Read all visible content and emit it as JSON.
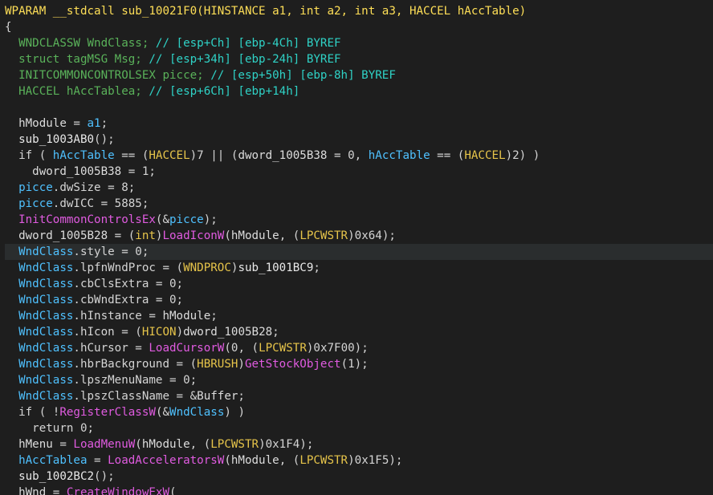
{
  "editor": {
    "theme": {
      "background": "#1e1e1e",
      "highlight_line": "#2a2d2e"
    },
    "lines": [
      [
        {
          "t": "WPARAM __stdcall sub_10021F0(HINSTANCE a1, int a2, int a3, HACCEL hAccTable)",
          "c": "sig"
        }
      ],
      [
        {
          "t": "{",
          "c": "plain"
        }
      ],
      [
        {
          "t": "  WNDCLASSW WndClass; ",
          "c": "green"
        },
        {
          "t": "// [esp+Ch] [ebp-4Ch] BYREF",
          "c": "comment"
        }
      ],
      [
        {
          "t": "  struct tagMSG Msg; ",
          "c": "green"
        },
        {
          "t": "// [esp+34h] [ebp-24h] BYREF",
          "c": "comment"
        }
      ],
      [
        {
          "t": "  INITCOMMONCONTROLSEX picce; ",
          "c": "green"
        },
        {
          "t": "// [esp+50h] [ebp-8h] BYREF",
          "c": "comment"
        }
      ],
      [
        {
          "t": "  HACCEL hAccTablea; ",
          "c": "green"
        },
        {
          "t": "// [esp+6Ch] [ebp+14h]",
          "c": "comment"
        }
      ],
      [
        {
          "t": "",
          "c": "plain"
        }
      ],
      [
        {
          "t": "  hModule",
          "c": "glob"
        },
        {
          "t": " = ",
          "c": "punc"
        },
        {
          "t": "a1",
          "c": "var"
        },
        {
          "t": ";",
          "c": "punc"
        }
      ],
      [
        {
          "t": "  sub_1003AB0",
          "c": "func"
        },
        {
          "t": "();",
          "c": "punc"
        }
      ],
      [
        {
          "t": "  if ( ",
          "c": "kw"
        },
        {
          "t": "hAccTable",
          "c": "var"
        },
        {
          "t": " == (",
          "c": "punc"
        },
        {
          "t": "HACCEL",
          "c": "type2"
        },
        {
          "t": ")7 || (",
          "c": "punc"
        },
        {
          "t": "dword_1005B38",
          "c": "glob"
        },
        {
          "t": " = 0, ",
          "c": "punc"
        },
        {
          "t": "hAccTable",
          "c": "var"
        },
        {
          "t": " == (",
          "c": "punc"
        },
        {
          "t": "HACCEL",
          "c": "type2"
        },
        {
          "t": ")2) )",
          "c": "punc"
        }
      ],
      [
        {
          "t": "    dword_1005B38",
          "c": "glob"
        },
        {
          "t": " = 1;",
          "c": "punc"
        }
      ],
      [
        {
          "t": "  picce",
          "c": "var"
        },
        {
          "t": ".dwSize = 8;",
          "c": "punc"
        }
      ],
      [
        {
          "t": "  picce",
          "c": "var"
        },
        {
          "t": ".dwICC = 5885;",
          "c": "punc"
        }
      ],
      [
        {
          "t": "  InitCommonControlsEx",
          "c": "api"
        },
        {
          "t": "(&",
          "c": "punc"
        },
        {
          "t": "picce",
          "c": "var"
        },
        {
          "t": ");",
          "c": "punc"
        }
      ],
      [
        {
          "t": "  dword_1005B28",
          "c": "glob"
        },
        {
          "t": " = (",
          "c": "punc"
        },
        {
          "t": "int",
          "c": "type2"
        },
        {
          "t": ")",
          "c": "punc"
        },
        {
          "t": "LoadIconW",
          "c": "api"
        },
        {
          "t": "(",
          "c": "punc"
        },
        {
          "t": "hModule",
          "c": "glob"
        },
        {
          "t": ", (",
          "c": "punc"
        },
        {
          "t": "LPCWSTR",
          "c": "type2"
        },
        {
          "t": ")0x64);",
          "c": "punc"
        }
      ],
      [
        {
          "t": "  WndClass",
          "c": "var"
        },
        {
          "t": ".style = 0;",
          "c": "punc"
        }
      ],
      [
        {
          "t": "  WndClass",
          "c": "var"
        },
        {
          "t": ".lpfnWndProc = (",
          "c": "punc"
        },
        {
          "t": "WNDPROC",
          "c": "type2"
        },
        {
          "t": ")",
          "c": "punc"
        },
        {
          "t": "sub_1001BC9",
          "c": "func"
        },
        {
          "t": ";",
          "c": "punc"
        }
      ],
      [
        {
          "t": "  WndClass",
          "c": "var"
        },
        {
          "t": ".cbClsExtra = 0;",
          "c": "punc"
        }
      ],
      [
        {
          "t": "  WndClass",
          "c": "var"
        },
        {
          "t": ".cbWndExtra = 0;",
          "c": "punc"
        }
      ],
      [
        {
          "t": "  WndClass",
          "c": "var"
        },
        {
          "t": ".hInstance = ",
          "c": "punc"
        },
        {
          "t": "hModule",
          "c": "glob"
        },
        {
          "t": ";",
          "c": "punc"
        }
      ],
      [
        {
          "t": "  WndClass",
          "c": "var"
        },
        {
          "t": ".hIcon = (",
          "c": "punc"
        },
        {
          "t": "HICON",
          "c": "type2"
        },
        {
          "t": ")",
          "c": "punc"
        },
        {
          "t": "dword_1005B28",
          "c": "glob"
        },
        {
          "t": ";",
          "c": "punc"
        }
      ],
      [
        {
          "t": "  WndClass",
          "c": "var"
        },
        {
          "t": ".hCursor = ",
          "c": "punc"
        },
        {
          "t": "LoadCursorW",
          "c": "api"
        },
        {
          "t": "(0, (",
          "c": "punc"
        },
        {
          "t": "LPCWSTR",
          "c": "type2"
        },
        {
          "t": ")0x7F00);",
          "c": "punc"
        }
      ],
      [
        {
          "t": "  WndClass",
          "c": "var"
        },
        {
          "t": ".hbrBackground = (",
          "c": "punc"
        },
        {
          "t": "HBRUSH",
          "c": "type2"
        },
        {
          "t": ")",
          "c": "punc"
        },
        {
          "t": "GetStockObject",
          "c": "api"
        },
        {
          "t": "(1);",
          "c": "punc"
        }
      ],
      [
        {
          "t": "  WndClass",
          "c": "var"
        },
        {
          "t": ".lpszMenuName = 0;",
          "c": "punc"
        }
      ],
      [
        {
          "t": "  WndClass",
          "c": "var"
        },
        {
          "t": ".lpszClassName = &",
          "c": "punc"
        },
        {
          "t": "Buffer",
          "c": "glob"
        },
        {
          "t": ";",
          "c": "punc"
        }
      ],
      [
        {
          "t": "  if ( !",
          "c": "kw"
        },
        {
          "t": "RegisterClassW",
          "c": "api"
        },
        {
          "t": "(&",
          "c": "punc"
        },
        {
          "t": "WndClass",
          "c": "var"
        },
        {
          "t": ") )",
          "c": "punc"
        }
      ],
      [
        {
          "t": "    return 0;",
          "c": "kw"
        }
      ],
      [
        {
          "t": "  hMenu",
          "c": "glob"
        },
        {
          "t": " = ",
          "c": "punc"
        },
        {
          "t": "LoadMenuW",
          "c": "api"
        },
        {
          "t": "(",
          "c": "punc"
        },
        {
          "t": "hModule",
          "c": "glob"
        },
        {
          "t": ", (",
          "c": "punc"
        },
        {
          "t": "LPCWSTR",
          "c": "type2"
        },
        {
          "t": ")0x1F4);",
          "c": "punc"
        }
      ],
      [
        {
          "t": "  hAccTablea",
          "c": "var"
        },
        {
          "t": " = ",
          "c": "punc"
        },
        {
          "t": "LoadAcceleratorsW",
          "c": "api"
        },
        {
          "t": "(",
          "c": "punc"
        },
        {
          "t": "hModule",
          "c": "glob"
        },
        {
          "t": ", (",
          "c": "punc"
        },
        {
          "t": "LPCWSTR",
          "c": "type2"
        },
        {
          "t": ")0x1F5);",
          "c": "punc"
        }
      ],
      [
        {
          "t": "  sub_1002BC2",
          "c": "func"
        },
        {
          "t": "();",
          "c": "punc"
        }
      ],
      [
        {
          "t": "  hWnd",
          "c": "glob"
        },
        {
          "t": " = ",
          "c": "punc"
        },
        {
          "t": "CreateWindowExW",
          "c": "api"
        },
        {
          "t": "(",
          "c": "punc"
        }
      ]
    ],
    "highlighted_line": 15
  }
}
